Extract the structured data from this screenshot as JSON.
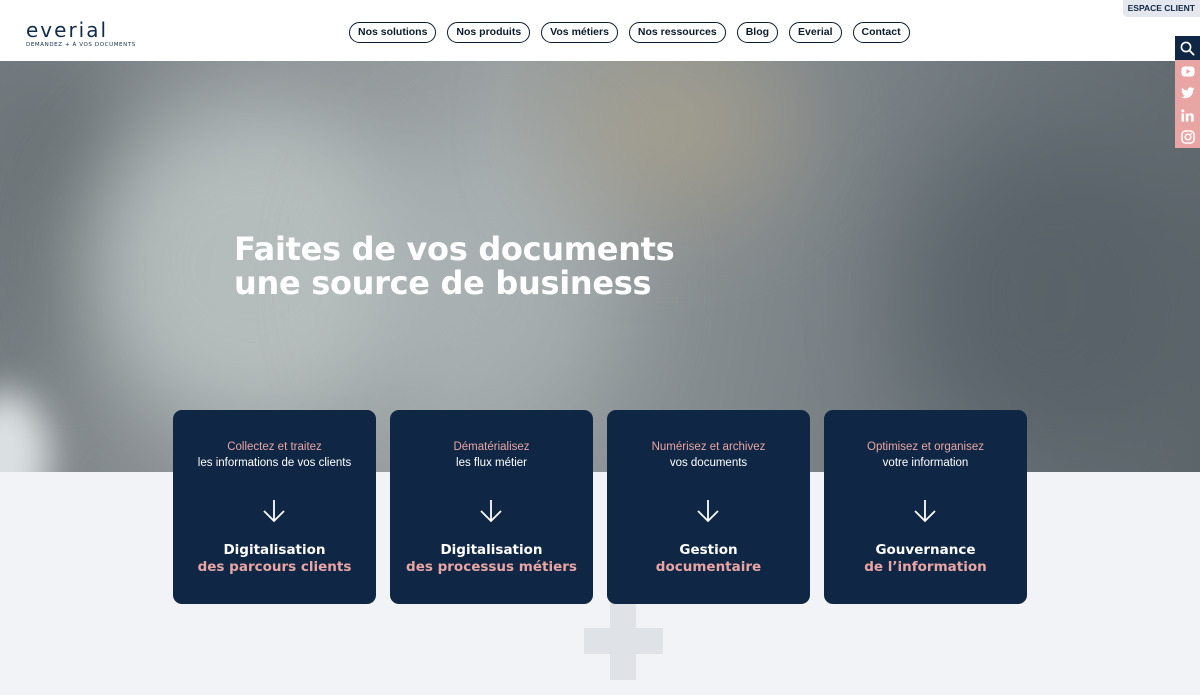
{
  "header": {
    "logo": {
      "word": "everial",
      "tagline": "DEMANDEZ + À VOS DOCUMENTS"
    },
    "nav": [
      {
        "label": "Nos solutions"
      },
      {
        "label": "Nos produits"
      },
      {
        "label": "Vos métiers"
      },
      {
        "label": "Nos ressources"
      },
      {
        "label": "Blog"
      },
      {
        "label": "Everial"
      },
      {
        "label": "Contact"
      }
    ],
    "espace_client": "ESPACE CLIENT"
  },
  "social": {
    "icons": [
      "search-icon",
      "youtube-icon",
      "twitter-icon",
      "linkedin-icon",
      "instagram-icon"
    ],
    "colors": {
      "search_bg": "#0f2744",
      "item_bg": "#e9a5a4"
    }
  },
  "hero": {
    "title_line1": "Faites de vos documents",
    "title_line2": "une source de business"
  },
  "cards": [
    {
      "intro_accent": "Collectez et traitez",
      "intro_text": "les informations de vos clients",
      "title_line1": "Digitalisation",
      "title_line2": "des parcours clients"
    },
    {
      "intro_accent": "Dématérialisez",
      "intro_text": "les flux métier",
      "title_line1": "Digitalisation",
      "title_line2": "des processus métiers"
    },
    {
      "intro_accent": "Numérisez et archivez",
      "intro_text": "vos documents",
      "title_line1": "Gestion",
      "title_line2": "documentaire"
    },
    {
      "intro_accent": "Optimisez et organisez",
      "intro_text": "votre information",
      "title_line1": "Gouvernance",
      "title_line2": "de l’information"
    }
  ],
  "colors": {
    "navy": "#0f2744",
    "pink": "#e9a5a4",
    "page_bg": "#f1f3f6"
  }
}
